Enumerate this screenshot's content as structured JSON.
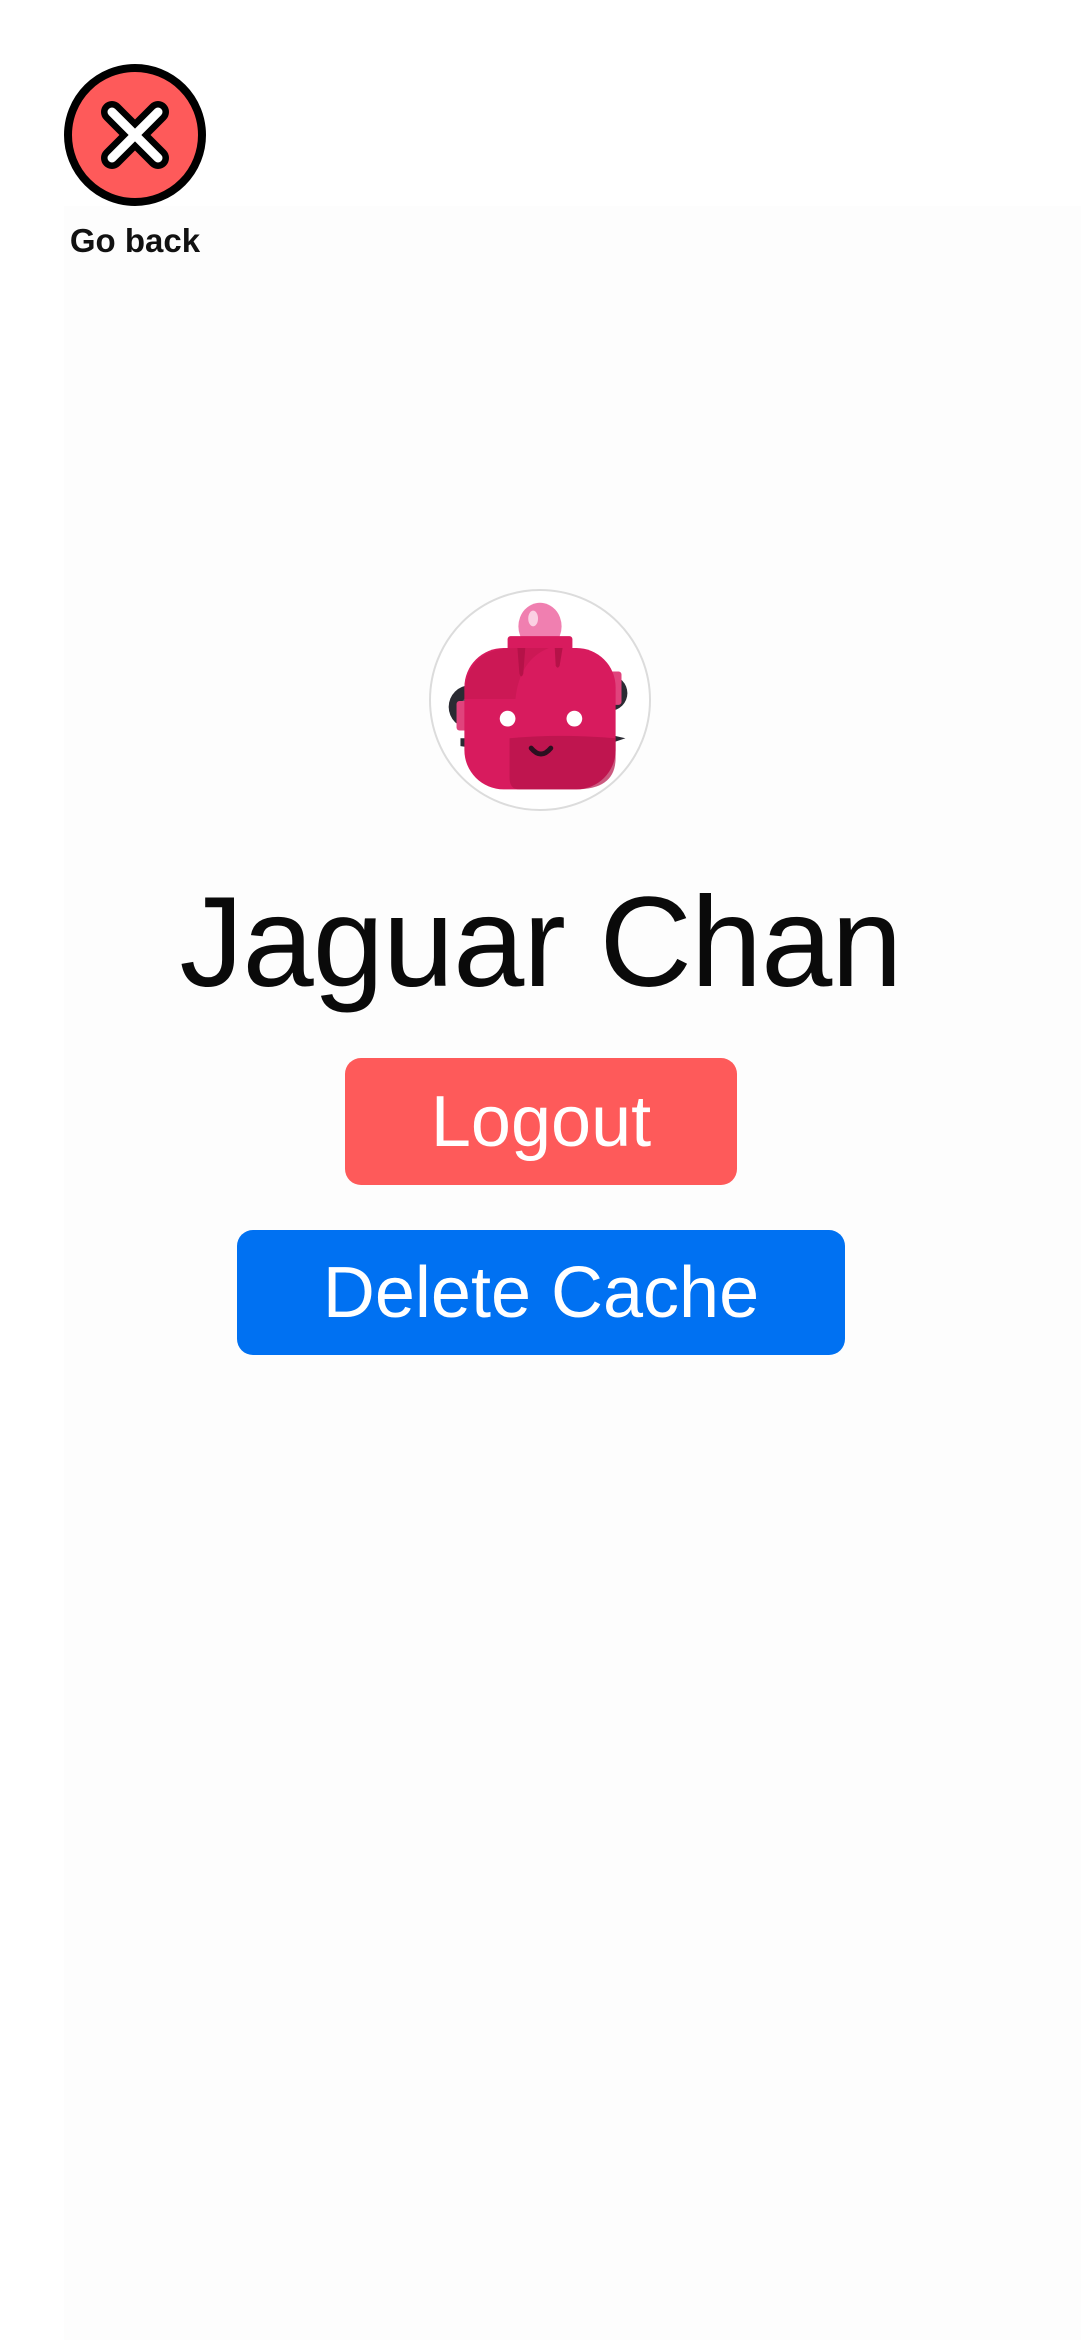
{
  "header": {
    "go_back_label": "Go back",
    "go_back_icon": "close-circle-icon"
  },
  "profile": {
    "avatar_icon": "robot-avatar-icon",
    "name": "Jaguar Chan"
  },
  "actions": {
    "logout_label": "Logout",
    "delete_cache_label": "Delete Cache"
  },
  "colors": {
    "logout_bg": "#fe5a5a",
    "delete_cache_bg": "#0071f2",
    "go_back_icon_fill": "#fe5a5a",
    "avatar_primary": "#d81b5e"
  }
}
